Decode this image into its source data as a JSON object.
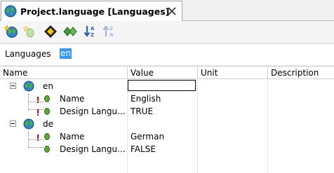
{
  "tab": {
    "title": "Project.language [Languages]"
  },
  "toolbar": {
    "buttons": [
      "add-language-icon",
      "add-property-icon",
      "move-icon",
      "diamond-pair-icon",
      "sort-ascending-icon",
      "sort-descending-icon"
    ]
  },
  "language_field": {
    "label": "Languages",
    "value": "en"
  },
  "grid": {
    "columns": [
      "Name",
      "Value",
      "Unit",
      "Description"
    ],
    "groups": [
      {
        "name": "en",
        "properties": [
          {
            "name": "Name",
            "value": "English"
          },
          {
            "name": "Design Langu...",
            "value": "TRUE"
          }
        ]
      },
      {
        "name": "de",
        "properties": [
          {
            "name": "Name",
            "value": "German"
          },
          {
            "name": "Design Langu...",
            "value": "FALSE"
          }
        ]
      }
    ]
  },
  "colors": {
    "selection": "#3399ff",
    "property_dot": "#5aa832",
    "alert": "#e00000"
  }
}
